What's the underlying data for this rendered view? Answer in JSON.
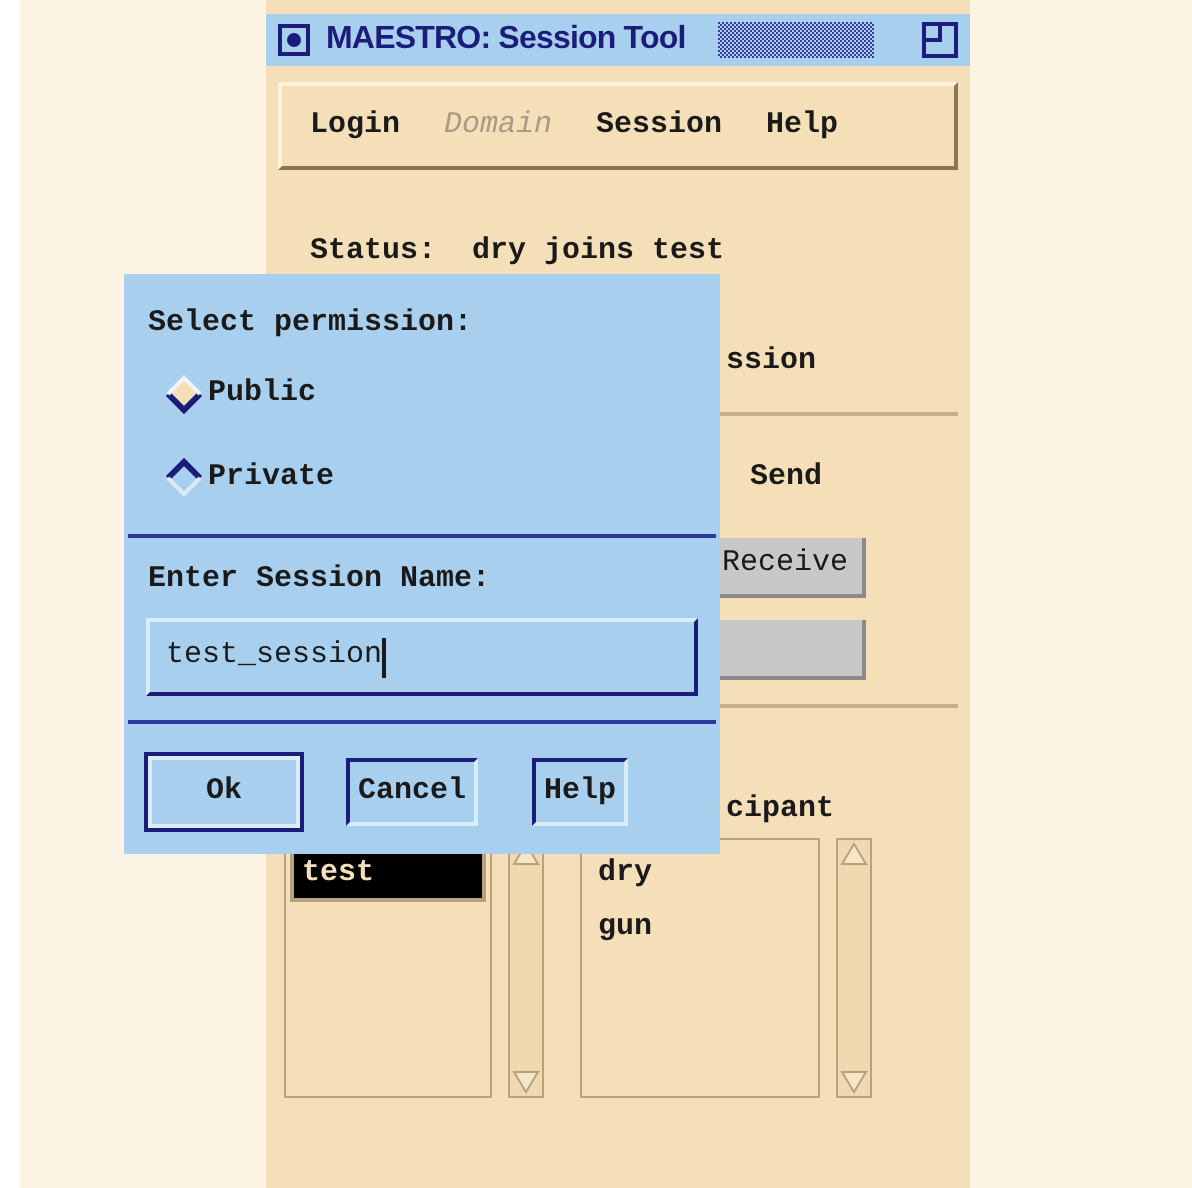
{
  "window": {
    "title": "MAESTRO: Session Tool"
  },
  "menu": [
    {
      "label": "Login",
      "disabled": false
    },
    {
      "label": "Domain",
      "disabled": true
    },
    {
      "label": "Session",
      "disabled": false
    },
    {
      "label": "Help",
      "disabled": false
    }
  ],
  "status": {
    "label": "Status:",
    "value": "dry joins test"
  },
  "covered": {
    "session_text": "ssion",
    "send_text": "Send",
    "receive_button": "Receive",
    "participant_heading": "cipant"
  },
  "session_list": {
    "items": [
      {
        "label": "test",
        "selected": true
      }
    ]
  },
  "participant_list": {
    "items": [
      {
        "label": "dry",
        "selected": false
      },
      {
        "label": "gun",
        "selected": false
      }
    ]
  },
  "dialog": {
    "permission_label": "Select permission:",
    "options": [
      {
        "label": "Public",
        "selected": true
      },
      {
        "label": "Private",
        "selected": false
      }
    ],
    "name_label": "Enter Session Name:",
    "name_value": "test_session",
    "buttons": [
      {
        "label": "Ok",
        "default": true
      },
      {
        "label": "Cancel",
        "default": false
      },
      {
        "label": "Help",
        "default": false
      }
    ]
  }
}
